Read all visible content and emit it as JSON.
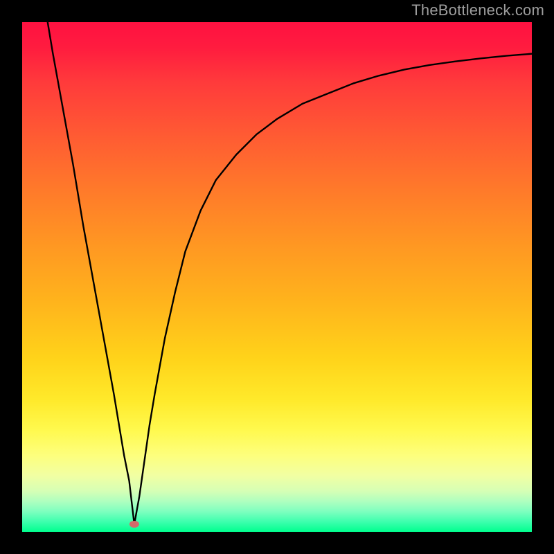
{
  "watermark": "TheBottleneck.com",
  "chart_data": {
    "type": "line",
    "title": "",
    "xlabel": "",
    "ylabel": "",
    "xlim": [
      0,
      100
    ],
    "ylim": [
      0,
      100
    ],
    "grid": false,
    "legend": false,
    "marker": {
      "x": 22,
      "y": 1.5,
      "color": "#d46a6a",
      "rx": 7,
      "ry": 5
    },
    "background_gradient": {
      "top": "#ff1141",
      "bottom": "#00ff8e",
      "stops": [
        {
          "offset": 0.0,
          "color": "#ff1141"
        },
        {
          "offset": 0.55,
          "color": "#ffb41c"
        },
        {
          "offset": 0.8,
          "color": "#fff94e"
        },
        {
          "offset": 1.0,
          "color": "#00ff8e"
        }
      ]
    },
    "series": [
      {
        "name": "curve",
        "color": "#000000",
        "x": [
          5,
          6,
          8,
          10,
          12,
          14,
          16,
          18,
          20,
          21,
          22,
          23,
          24,
          25,
          26,
          28,
          30,
          32,
          35,
          38,
          42,
          46,
          50,
          55,
          60,
          65,
          70,
          75,
          80,
          85,
          90,
          95,
          100
        ],
        "y": [
          100,
          94,
          83,
          72,
          60,
          49,
          38,
          27,
          15,
          10,
          1.5,
          7,
          14,
          21,
          27,
          38,
          47,
          55,
          63,
          69,
          74,
          78,
          81,
          84,
          86,
          88,
          89.5,
          90.7,
          91.6,
          92.3,
          92.9,
          93.4,
          93.8
        ]
      }
    ]
  }
}
